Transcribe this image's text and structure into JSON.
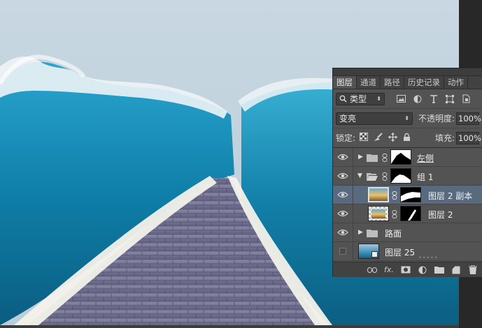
{
  "panel": {
    "tabs": [
      {
        "label": "图层",
        "active": true
      },
      {
        "label": "通道",
        "active": false
      },
      {
        "label": "路径",
        "active": false
      },
      {
        "label": "历史记录",
        "active": false
      },
      {
        "label": "动作",
        "active": false
      }
    ],
    "filter": {
      "label": "类型",
      "icons": [
        "image-filter-icon",
        "adjustment-filter-icon",
        "type-filter-icon",
        "shape-filter-icon",
        "smart-object-filter-icon"
      ]
    },
    "blend_mode": "变亮",
    "opacity_label": "不透明度:",
    "opacity_value": "100%",
    "lock_label": "锁定:",
    "fill_label": "填充:",
    "fill_value": "100%"
  },
  "layers": [
    {
      "name": "左侧",
      "type": "group",
      "expanded": false,
      "visible": true,
      "has_mask": true,
      "underline": true,
      "indent": 0
    },
    {
      "name": "组 1",
      "type": "group",
      "expanded": true,
      "visible": true,
      "has_mask": true,
      "underline": false,
      "indent": 0
    },
    {
      "name": "图层 2 副本",
      "type": "layer",
      "visible": true,
      "has_mask": true,
      "selected": true,
      "indent": 1
    },
    {
      "name": "图层 2",
      "type": "layer",
      "visible": true,
      "has_mask": true,
      "selected": false,
      "indent": 1
    },
    {
      "name": "路面",
      "type": "group",
      "expanded": false,
      "visible": true,
      "has_mask": false,
      "indent": 0
    },
    {
      "name": "图层 25",
      "type": "smart-layer",
      "visible": false,
      "has_mask": false,
      "indent": 0
    }
  ],
  "bottom_icons": [
    "link-layers-icon",
    "fx-icon",
    "add-mask-icon",
    "adjustment-layer-icon",
    "new-group-icon",
    "new-layer-icon",
    "delete-layer-icon"
  ],
  "bottom_fx_label": "fx."
}
